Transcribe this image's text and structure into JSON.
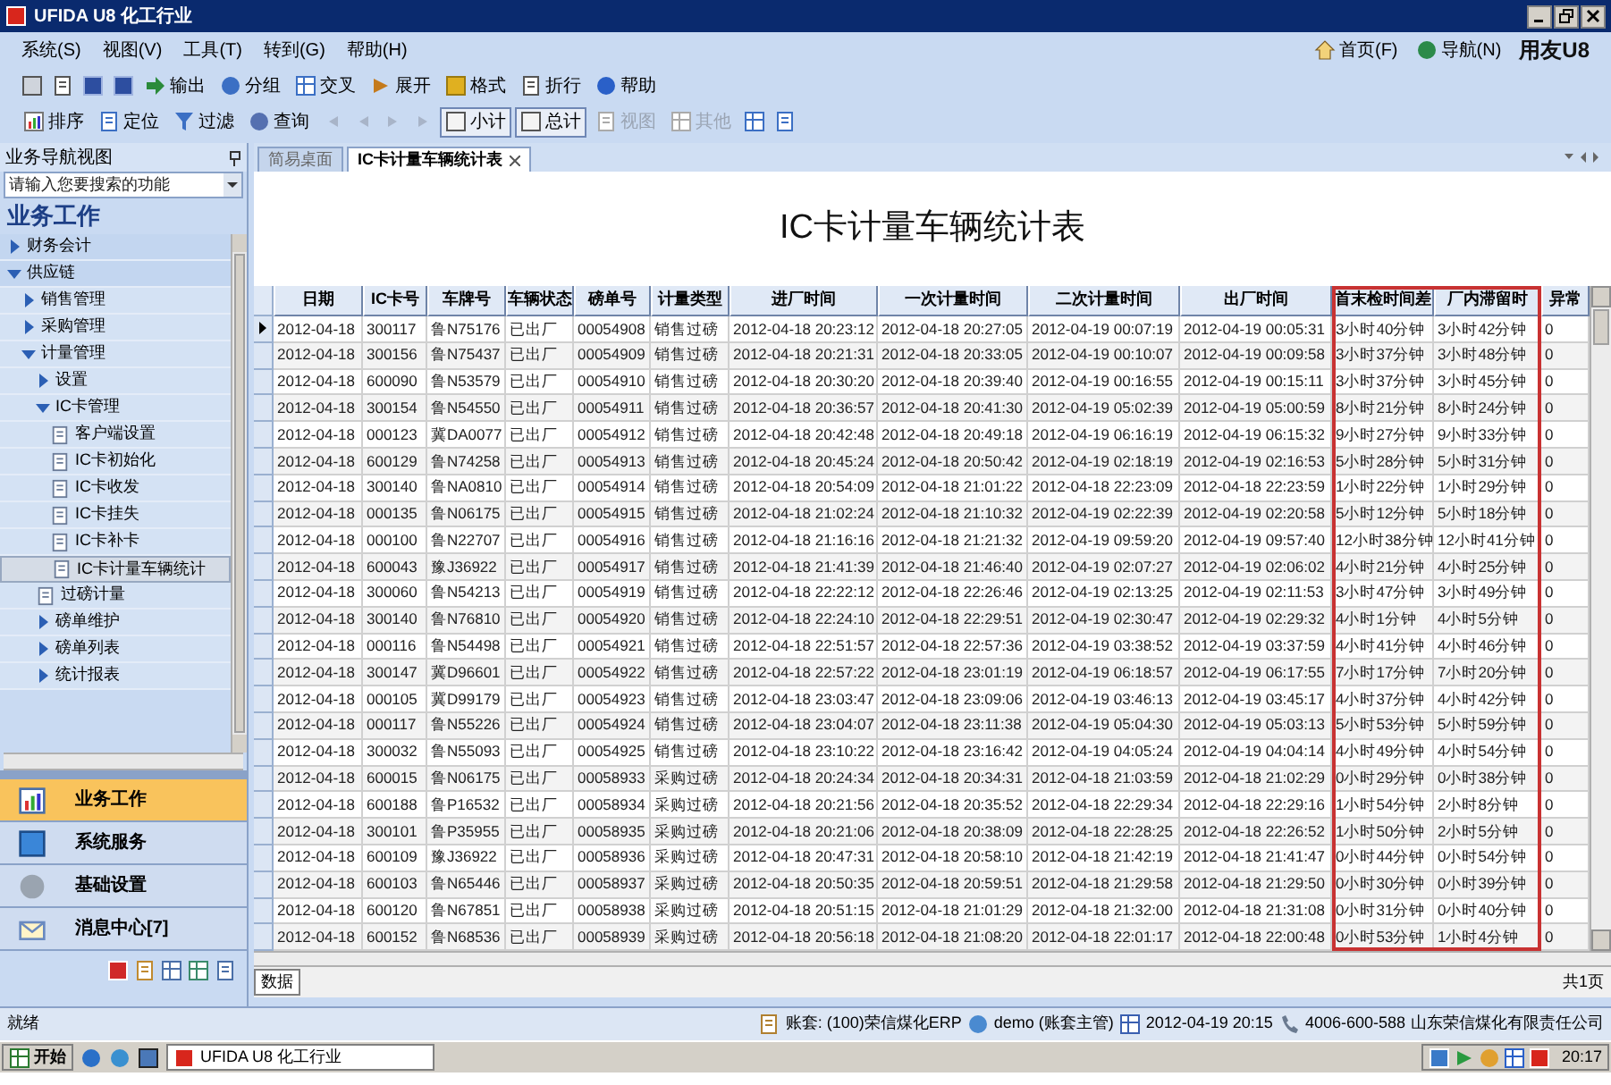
{
  "window": {
    "title": "UFIDA U8 化工行业"
  },
  "menu": [
    "系统(S)",
    "视图(V)",
    "工具(T)",
    "转到(G)",
    "帮助(H)"
  ],
  "top_links": [
    {
      "label": "首页(F)"
    },
    {
      "label": "导航(N)"
    }
  ],
  "brand": "用友U8",
  "toolbar1": [
    {
      "label": "输出"
    },
    {
      "label": "分组"
    },
    {
      "label": "交叉"
    },
    {
      "label": "展开"
    },
    {
      "label": "格式"
    },
    {
      "label": "折行"
    },
    {
      "label": "帮助"
    }
  ],
  "toolbar2": [
    {
      "label": "排序",
      "on": false,
      "disabled": false
    },
    {
      "label": "定位",
      "on": false,
      "disabled": false
    },
    {
      "label": "过滤",
      "on": false,
      "disabled": false
    },
    {
      "label": "查询",
      "on": false,
      "disabled": false
    },
    {
      "label": "小计",
      "on": true,
      "disabled": false
    },
    {
      "label": "总计",
      "on": true,
      "disabled": false
    },
    {
      "label": "视图",
      "on": false,
      "disabled": true
    },
    {
      "label": "其他",
      "on": false,
      "disabled": true
    }
  ],
  "sidebar": {
    "header": "业务导航视图",
    "search": {
      "placeholder": "请输入您要搜索的功能"
    },
    "section_title": "业务工作",
    "items": [
      {
        "label": "财务会计",
        "kind": "folder",
        "expanded": false,
        "selected": false
      },
      {
        "label": "供应链",
        "kind": "folder",
        "expanded": true,
        "selected": false,
        "children": [
          {
            "label": "销售管理",
            "kind": "folder",
            "expanded": false,
            "selected": false
          },
          {
            "label": "采购管理",
            "kind": "folder",
            "expanded": false,
            "selected": false
          },
          {
            "label": "计量管理",
            "kind": "folder",
            "expanded": true,
            "selected": false,
            "children": [
              {
                "label": "设置",
                "kind": "folder",
                "expanded": false,
                "selected": false
              },
              {
                "label": "IC卡管理",
                "kind": "folder",
                "expanded": true,
                "selected": false,
                "children": [
                  {
                    "label": "客户端设置",
                    "kind": "report",
                    "selected": false
                  },
                  {
                    "label": "IC卡初始化",
                    "kind": "report",
                    "selected": false
                  },
                  {
                    "label": "IC卡收发",
                    "kind": "report",
                    "selected": false
                  },
                  {
                    "label": "IC卡挂失",
                    "kind": "report",
                    "selected": false
                  },
                  {
                    "label": "IC卡补卡",
                    "kind": "report",
                    "selected": false
                  },
                  {
                    "label": "IC卡计量车辆统计",
                    "kind": "report",
                    "selected": true
                  }
                ]
              },
              {
                "label": "过磅计量",
                "kind": "report",
                "selected": false
              },
              {
                "label": "磅单维护",
                "kind": "folder",
                "expanded": false,
                "selected": false
              },
              {
                "label": "磅单列表",
                "kind": "folder",
                "expanded": false,
                "selected": false
              },
              {
                "label": "统计报表",
                "kind": "folder",
                "expanded": false,
                "selected": false
              }
            ]
          }
        ]
      }
    ],
    "nav_buttons": [
      {
        "label": "业务工作",
        "selected": true
      },
      {
        "label": "系统服务",
        "selected": false
      },
      {
        "label": "基础设置",
        "selected": false
      },
      {
        "label": "消息中心[7]",
        "selected": false
      }
    ]
  },
  "tabs": [
    {
      "label": "简易桌面",
      "selected": false
    },
    {
      "label": "IC卡计量车辆统计表",
      "selected": true
    }
  ],
  "report": {
    "title": "IC卡计量车辆统计表",
    "columns": [
      "日期",
      "IC卡号",
      "车牌号",
      "车辆状态",
      "磅单号",
      "计量类型",
      "进厂时间",
      "一次计量时间",
      "二次计量时间",
      "出厂时间",
      "首末检时间差",
      "厂内滞留时",
      "异常"
    ],
    "rows": [
      {
        "selected": true,
        "cells": [
          "2012-04-18",
          "300117",
          "鲁N75176",
          "已出厂",
          "00054908",
          "销售过磅",
          "2012-04-18 20:23:12",
          "2012-04-18 20:27:05",
          "2012-04-19 00:07:19",
          "2012-04-19 00:05:31",
          "3小时40分钟",
          "3小时42分钟",
          "0"
        ]
      },
      {
        "selected": false,
        "cells": [
          "2012-04-18",
          "300156",
          "鲁N75437",
          "已出厂",
          "00054909",
          "销售过磅",
          "2012-04-18 20:21:31",
          "2012-04-18 20:33:05",
          "2012-04-19 00:10:07",
          "2012-04-19 00:09:58",
          "3小时37分钟",
          "3小时48分钟",
          "0"
        ]
      },
      {
        "selected": false,
        "cells": [
          "2012-04-18",
          "600090",
          "鲁N53579",
          "已出厂",
          "00054910",
          "销售过磅",
          "2012-04-18 20:30:20",
          "2012-04-18 20:39:40",
          "2012-04-19 00:16:55",
          "2012-04-19 00:15:11",
          "3小时37分钟",
          "3小时45分钟",
          "0"
        ]
      },
      {
        "selected": false,
        "cells": [
          "2012-04-18",
          "300154",
          "鲁N54550",
          "已出厂",
          "00054911",
          "销售过磅",
          "2012-04-18 20:36:57",
          "2012-04-18 20:41:30",
          "2012-04-19 05:02:39",
          "2012-04-19 05:00:59",
          "8小时21分钟",
          "8小时24分钟",
          "0"
        ]
      },
      {
        "selected": false,
        "cells": [
          "2012-04-18",
          "000123",
          "冀DA0077",
          "已出厂",
          "00054912",
          "销售过磅",
          "2012-04-18 20:42:48",
          "2012-04-18 20:49:18",
          "2012-04-19 06:16:19",
          "2012-04-19 06:15:32",
          "9小时27分钟",
          "9小时33分钟",
          "0"
        ]
      },
      {
        "selected": false,
        "cells": [
          "2012-04-18",
          "600129",
          "鲁N74258",
          "已出厂",
          "00054913",
          "销售过磅",
          "2012-04-18 20:45:24",
          "2012-04-18 20:50:42",
          "2012-04-19 02:18:19",
          "2012-04-19 02:16:53",
          "5小时28分钟",
          "5小时31分钟",
          "0"
        ]
      },
      {
        "selected": false,
        "cells": [
          "2012-04-18",
          "300140",
          "鲁NA0810",
          "已出厂",
          "00054914",
          "销售过磅",
          "2012-04-18 20:54:09",
          "2012-04-18 21:01:22",
          "2012-04-18 22:23:09",
          "2012-04-18 22:23:59",
          "1小时22分钟",
          "1小时29分钟",
          "0"
        ]
      },
      {
        "selected": false,
        "cells": [
          "2012-04-18",
          "000135",
          "鲁N06175",
          "已出厂",
          "00054915",
          "销售过磅",
          "2012-04-18 21:02:24",
          "2012-04-18 21:10:32",
          "2012-04-19 02:22:39",
          "2012-04-19 02:20:58",
          "5小时12分钟",
          "5小时18分钟",
          "0"
        ]
      },
      {
        "selected": false,
        "cells": [
          "2012-04-18",
          "000100",
          "鲁N22707",
          "已出厂",
          "00054916",
          "销售过磅",
          "2012-04-18 21:16:16",
          "2012-04-18 21:21:32",
          "2012-04-19 09:59:20",
          "2012-04-19 09:57:40",
          "12小时38分钟",
          "12小时41分钟",
          "0"
        ]
      },
      {
        "selected": false,
        "cells": [
          "2012-04-18",
          "600043",
          "豫J36922",
          "已出厂",
          "00054917",
          "销售过磅",
          "2012-04-18 21:41:39",
          "2012-04-18 21:46:40",
          "2012-04-19 02:07:27",
          "2012-04-19 02:06:02",
          "4小时21分钟",
          "4小时25分钟",
          "0"
        ]
      },
      {
        "selected": false,
        "cells": [
          "2012-04-18",
          "300060",
          "鲁N54213",
          "已出厂",
          "00054919",
          "销售过磅",
          "2012-04-18 22:22:12",
          "2012-04-18 22:26:46",
          "2012-04-19 02:13:25",
          "2012-04-19 02:11:53",
          "3小时47分钟",
          "3小时49分钟",
          "0"
        ]
      },
      {
        "selected": false,
        "cells": [
          "2012-04-18",
          "300140",
          "鲁N76810",
          "已出厂",
          "00054920",
          "销售过磅",
          "2012-04-18 22:24:10",
          "2012-04-18 22:29:51",
          "2012-04-19 02:30:47",
          "2012-04-19 02:29:32",
          "4小时1分钟",
          "4小时5分钟",
          "0"
        ]
      },
      {
        "selected": false,
        "cells": [
          "2012-04-18",
          "000116",
          "鲁N54498",
          "已出厂",
          "00054921",
          "销售过磅",
          "2012-04-18 22:51:57",
          "2012-04-18 22:57:36",
          "2012-04-19 03:38:52",
          "2012-04-19 03:37:59",
          "4小时41分钟",
          "4小时46分钟",
          "0"
        ]
      },
      {
        "selected": false,
        "cells": [
          "2012-04-18",
          "300147",
          "冀D96601",
          "已出厂",
          "00054922",
          "销售过磅",
          "2012-04-18 22:57:22",
          "2012-04-18 23:01:19",
          "2012-04-19 06:18:57",
          "2012-04-19 06:17:55",
          "7小时17分钟",
          "7小时20分钟",
          "0"
        ]
      },
      {
        "selected": false,
        "cells": [
          "2012-04-18",
          "000105",
          "冀D99179",
          "已出厂",
          "00054923",
          "销售过磅",
          "2012-04-18 23:03:47",
          "2012-04-18 23:09:06",
          "2012-04-19 03:46:13",
          "2012-04-19 03:45:17",
          "4小时37分钟",
          "4小时42分钟",
          "0"
        ]
      },
      {
        "selected": false,
        "cells": [
          "2012-04-18",
          "000117",
          "鲁N55226",
          "已出厂",
          "00054924",
          "销售过磅",
          "2012-04-18 23:04:07",
          "2012-04-18 23:11:38",
          "2012-04-19 05:04:30",
          "2012-04-19 05:03:13",
          "5小时53分钟",
          "5小时59分钟",
          "0"
        ]
      },
      {
        "selected": false,
        "cells": [
          "2012-04-18",
          "300032",
          "鲁N55093",
          "已出厂",
          "00054925",
          "销售过磅",
          "2012-04-18 23:10:22",
          "2012-04-18 23:16:42",
          "2012-04-19 04:05:24",
          "2012-04-19 04:04:14",
          "4小时49分钟",
          "4小时54分钟",
          "0"
        ]
      },
      {
        "selected": false,
        "cells": [
          "2012-04-18",
          "600015",
          "鲁N06175",
          "已出厂",
          "00058933",
          "采购过磅",
          "2012-04-18 20:24:34",
          "2012-04-18 20:34:31",
          "2012-04-18 21:03:59",
          "2012-04-18 21:02:29",
          "0小时29分钟",
          "0小时38分钟",
          "0"
        ]
      },
      {
        "selected": false,
        "cells": [
          "2012-04-18",
          "600188",
          "鲁P16532",
          "已出厂",
          "00058934",
          "采购过磅",
          "2012-04-18 20:21:56",
          "2012-04-18 20:35:52",
          "2012-04-18 22:29:34",
          "2012-04-18 22:29:16",
          "1小时54分钟",
          "2小时8分钟",
          "0"
        ]
      },
      {
        "selected": false,
        "cells": [
          "2012-04-18",
          "300101",
          "鲁P35955",
          "已出厂",
          "00058935",
          "采购过磅",
          "2012-04-18 20:21:06",
          "2012-04-18 20:38:09",
          "2012-04-18 22:28:25",
          "2012-04-18 22:26:52",
          "1小时50分钟",
          "2小时5分钟",
          "0"
        ]
      },
      {
        "selected": false,
        "cells": [
          "2012-04-18",
          "600109",
          "豫J36922",
          "已出厂",
          "00058936",
          "采购过磅",
          "2012-04-18 20:47:31",
          "2012-04-18 20:58:10",
          "2012-04-18 21:42:19",
          "2012-04-18 21:41:47",
          "0小时44分钟",
          "0小时54分钟",
          "0"
        ]
      },
      {
        "selected": false,
        "cells": [
          "2012-04-18",
          "600103",
          "鲁N65446",
          "已出厂",
          "00058937",
          "采购过磅",
          "2012-04-18 20:50:35",
          "2012-04-18 20:59:51",
          "2012-04-18 21:29:58",
          "2012-04-18 21:29:50",
          "0小时30分钟",
          "0小时39分钟",
          "0"
        ]
      },
      {
        "selected": false,
        "cells": [
          "2012-04-18",
          "600120",
          "鲁N67851",
          "已出厂",
          "00058938",
          "采购过磅",
          "2012-04-18 20:51:15",
          "2012-04-18 21:01:29",
          "2012-04-18 21:32:00",
          "2012-04-18 21:31:08",
          "0小时31分钟",
          "0小时40分钟",
          "0"
        ]
      },
      {
        "selected": false,
        "cells": [
          "2012-04-18",
          "600152",
          "鲁N68536",
          "已出厂",
          "00058939",
          "采购过磅",
          "2012-04-18 20:56:18",
          "2012-04-18 21:08:20",
          "2012-04-18 22:01:17",
          "2012-04-18 22:00:48",
          "0小时53分钟",
          "1小时4分钟",
          "0"
        ]
      }
    ],
    "sheet_tab": "数据",
    "page_count": "共1页"
  },
  "status_bar": {
    "text": "就绪",
    "items": [
      "账套: (100)荣信煤化ERP",
      "demo (账套主管)",
      "2012-04-19 20:15",
      "4006-600-588",
      "山东荣信煤化有限责任公司"
    ]
  },
  "taskbar": {
    "start": "开始",
    "task": "UFIDA U8 化工行业",
    "clock": "20:17"
  }
}
